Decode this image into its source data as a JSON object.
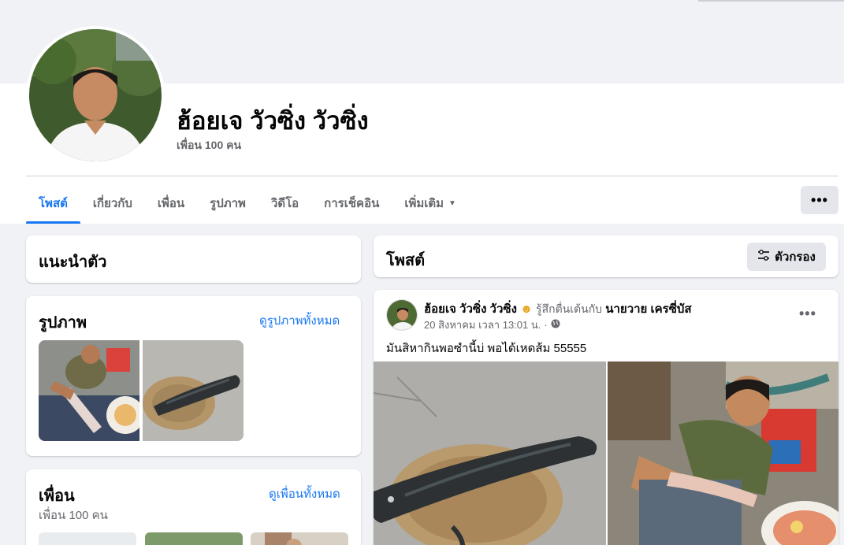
{
  "profile": {
    "name": "ฮ้อยเจ วัวซิ่ง วัวซิ่ง",
    "friends_count": "เพื่อน 100 คน"
  },
  "tabs": [
    {
      "label": "โพสต์",
      "active": true
    },
    {
      "label": "เกี่ยวกับ"
    },
    {
      "label": "เพื่อน"
    },
    {
      "label": "รูปภาพ"
    },
    {
      "label": "วิดีโอ"
    },
    {
      "label": "การเช็คอิน"
    },
    {
      "label": "เพิ่มเติม"
    }
  ],
  "intro": {
    "title": "แนะนำตัว"
  },
  "photos": {
    "title": "รูปภาพ",
    "see_all": "ดูรูปภาพทั้งหมด"
  },
  "friends": {
    "title": "เพื่อน",
    "count": "เพื่อน 100 คน",
    "see_all": "ดูเพื่อนทั้งหมด"
  },
  "posts": {
    "title": "โพสต์",
    "filter_label": "ตัวกรอง"
  },
  "post": {
    "author": "ฮ้อยเจ วัวซิ่ง วัวซิ่ง",
    "feeling_text": "รู้สึกตื่นเต้นกับ",
    "tagged": "นายวาย เครซี่บัส",
    "date": "20 สิงหาคม เวลา 13:01 น.",
    "body": "มันสิหากินพอซำนี้บ่ พอได้เหดส้ม 55555"
  },
  "colors": {
    "accent": "#1877f2",
    "secondary_text": "#65676b",
    "background": "#f0f2f5"
  }
}
